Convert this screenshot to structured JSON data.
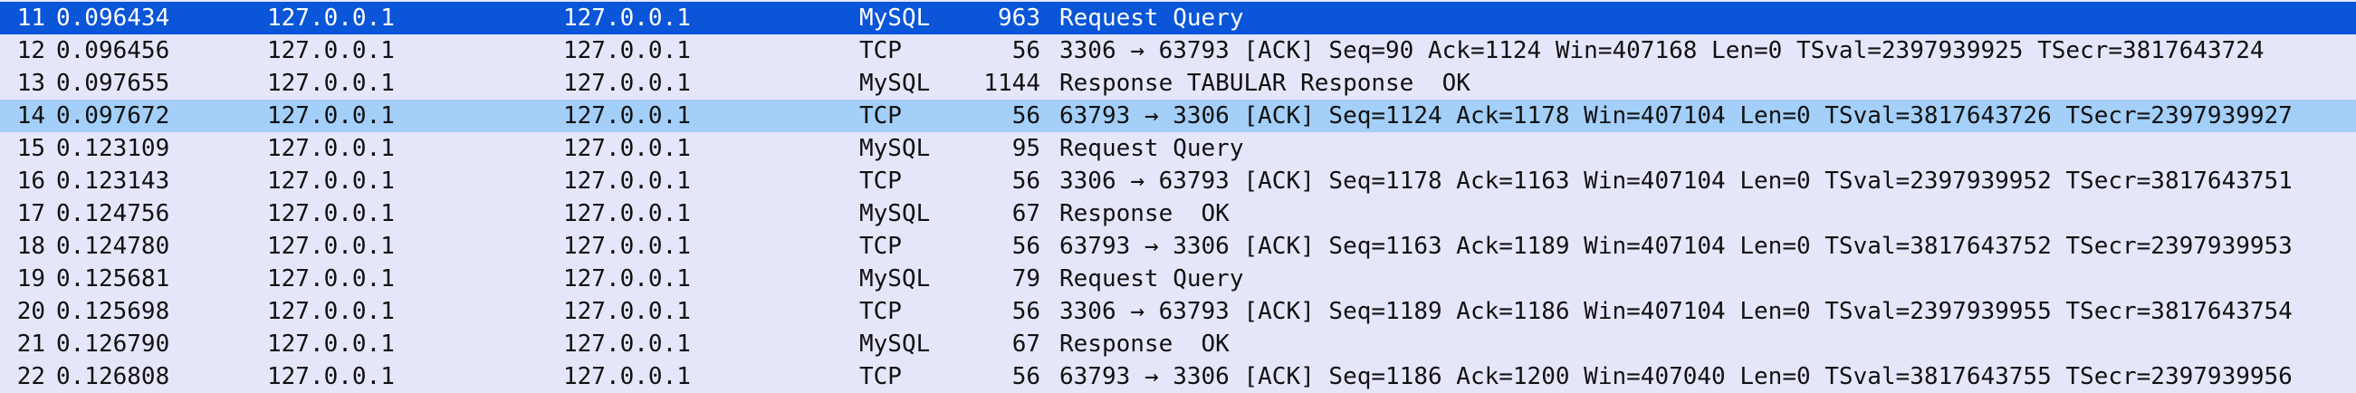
{
  "colors": {
    "background": "#e6e6fb",
    "selected_row": "#0a55d8",
    "related_row": "#a3cff8",
    "selected_text": "#ffffff",
    "text": "#111111"
  },
  "packets": [
    {
      "no": "11",
      "time": "0.096434",
      "source": "127.0.0.1",
      "destination": "127.0.0.1",
      "protocol": "MySQL",
      "length": "963",
      "info": "Request Query",
      "state": "selected"
    },
    {
      "no": "12",
      "time": "0.096456",
      "source": "127.0.0.1",
      "destination": "127.0.0.1",
      "protocol": "TCP",
      "length": "56",
      "info": "3306 → 63793 [ACK] Seq=90 Ack=1124 Win=407168 Len=0 TSval=2397939925 TSecr=3817643724",
      "state": "normal"
    },
    {
      "no": "13",
      "time": "0.097655",
      "source": "127.0.0.1",
      "destination": "127.0.0.1",
      "protocol": "MySQL",
      "length": "1144",
      "info": "Response TABULAR Response  OK",
      "state": "normal"
    },
    {
      "no": "14",
      "time": "0.097672",
      "source": "127.0.0.1",
      "destination": "127.0.0.1",
      "protocol": "TCP",
      "length": "56",
      "info": "63793 → 3306 [ACK] Seq=1124 Ack=1178 Win=407104 Len=0 TSval=3817643726 TSecr=2397939927",
      "state": "related"
    },
    {
      "no": "15",
      "time": "0.123109",
      "source": "127.0.0.1",
      "destination": "127.0.0.1",
      "protocol": "MySQL",
      "length": "95",
      "info": "Request Query",
      "state": "normal"
    },
    {
      "no": "16",
      "time": "0.123143",
      "source": "127.0.0.1",
      "destination": "127.0.0.1",
      "protocol": "TCP",
      "length": "56",
      "info": "3306 → 63793 [ACK] Seq=1178 Ack=1163 Win=407104 Len=0 TSval=2397939952 TSecr=3817643751",
      "state": "normal"
    },
    {
      "no": "17",
      "time": "0.124756",
      "source": "127.0.0.1",
      "destination": "127.0.0.1",
      "protocol": "MySQL",
      "length": "67",
      "info": "Response  OK",
      "state": "normal"
    },
    {
      "no": "18",
      "time": "0.124780",
      "source": "127.0.0.1",
      "destination": "127.0.0.1",
      "protocol": "TCP",
      "length": "56",
      "info": "63793 → 3306 [ACK] Seq=1163 Ack=1189 Win=407104 Len=0 TSval=3817643752 TSecr=2397939953",
      "state": "normal"
    },
    {
      "no": "19",
      "time": "0.125681",
      "source": "127.0.0.1",
      "destination": "127.0.0.1",
      "protocol": "MySQL",
      "length": "79",
      "info": "Request Query",
      "state": "normal"
    },
    {
      "no": "20",
      "time": "0.125698",
      "source": "127.0.0.1",
      "destination": "127.0.0.1",
      "protocol": "TCP",
      "length": "56",
      "info": "3306 → 63793 [ACK] Seq=1189 Ack=1186 Win=407104 Len=0 TSval=2397939955 TSecr=3817643754",
      "state": "normal"
    },
    {
      "no": "21",
      "time": "0.126790",
      "source": "127.0.0.1",
      "destination": "127.0.0.1",
      "protocol": "MySQL",
      "length": "67",
      "info": "Response  OK",
      "state": "normal"
    },
    {
      "no": "22",
      "time": "0.126808",
      "source": "127.0.0.1",
      "destination": "127.0.0.1",
      "protocol": "TCP",
      "length": "56",
      "info": "63793 → 3306 [ACK] Seq=1186 Ack=1200 Win=407040 Len=0 TSval=3817643755 TSecr=2397939956",
      "state": "normal"
    }
  ]
}
